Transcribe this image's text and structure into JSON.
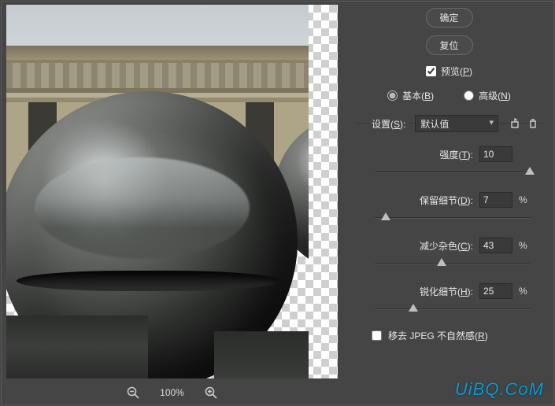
{
  "buttons": {
    "ok": "确定",
    "reset": "复位"
  },
  "preview_checkbox": {
    "label_pre": "预览(",
    "hotkey": "P",
    "label_post": ")",
    "checked": true
  },
  "mode": {
    "basic": {
      "pre": "基本(",
      "hk": "B",
      "post": ")"
    },
    "advanced": {
      "pre": "高级(",
      "hk": "N",
      "post": ")"
    },
    "selected": "basic"
  },
  "settings": {
    "label_pre": "设置(",
    "hk": "S",
    "label_post": "):",
    "value": "默认值"
  },
  "sliders": {
    "strength": {
      "label_pre": "强度(",
      "hk": "T",
      "label_post": "):",
      "value": "10",
      "percent": false,
      "pos": 100
    },
    "preserve": {
      "label_pre": "保留细节(",
      "hk": "D",
      "label_post": "):",
      "value": "7",
      "percent": true,
      "pos": 7
    },
    "reduce": {
      "label_pre": "减少杂色(",
      "hk": "C",
      "label_post": "):",
      "value": "43",
      "percent": true,
      "pos": 43
    },
    "sharpen": {
      "label_pre": "锐化细节(",
      "hk": "H",
      "label_post": "):",
      "value": "25",
      "percent": true,
      "pos": 25
    }
  },
  "remove_jpeg": {
    "label_pre": "移去 JPEG 不自然感(",
    "hk": "R",
    "label_post": ")",
    "checked": false
  },
  "zoom": {
    "level": "100%"
  },
  "watermark": "UiBQ.CoM",
  "percent_sign": "%"
}
